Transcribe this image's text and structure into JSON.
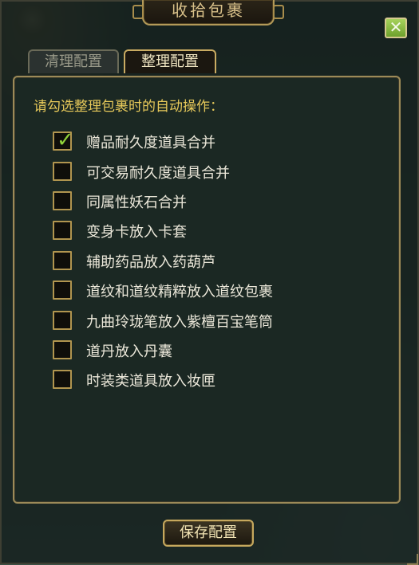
{
  "window": {
    "title": "收拾包裹",
    "close_glyph": "✕"
  },
  "tabs": [
    {
      "label": "清理配置",
      "active": false
    },
    {
      "label": "整理配置",
      "active": true
    }
  ],
  "panel": {
    "heading": "请勾选整理包裹时的自动操作：",
    "options": [
      {
        "label": "赠品耐久度道具合并",
        "checked": true
      },
      {
        "label": "可交易耐久度道具合并",
        "checked": false
      },
      {
        "label": "同属性妖石合并",
        "checked": false
      },
      {
        "label": "变身卡放入卡套",
        "checked": false
      },
      {
        "label": "辅助药品放入药葫芦",
        "checked": false
      },
      {
        "label": "道纹和道纹精粹放入道纹包裹",
        "checked": false
      },
      {
        "label": "九曲玲珑笔放入紫檀百宝笔筒",
        "checked": false
      },
      {
        "label": "道丹放入丹囊",
        "checked": false
      },
      {
        "label": "时装类道具放入妆匣",
        "checked": false
      }
    ],
    "check_glyph": "✓"
  },
  "footer": {
    "save_label": "保存配置"
  },
  "colors": {
    "accent_gold": "#c9ab62",
    "heading_yellow": "#e7c95a",
    "check_green": "#8fd13a",
    "close_green": "#8bbb44"
  }
}
